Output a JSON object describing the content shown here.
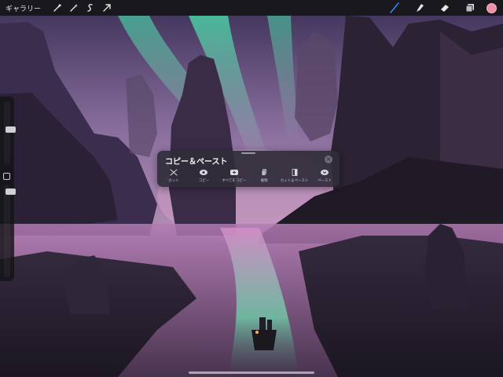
{
  "topbar": {
    "gallery_label": "ギャラリー",
    "left_tools": [
      "wrench-icon",
      "magic-wand-icon",
      "selection-icon",
      "transform-arrow-icon"
    ],
    "right_tools": [
      "brush-icon",
      "smudge-icon",
      "eraser-icon",
      "layers-icon"
    ],
    "active_color": "#f08fa8",
    "active_tool_color": "#3d7bff"
  },
  "copy_paste_panel": {
    "title": "コピー＆ペースト",
    "actions": [
      {
        "label": "カット",
        "icon": "scissors-icon"
      },
      {
        "label": "コピー",
        "icon": "copy-icon"
      },
      {
        "label": "すべてをコピー",
        "icon": "copy-all-icon"
      },
      {
        "label": "複製",
        "icon": "duplicate-icon"
      },
      {
        "label": "カット＆ペースト",
        "icon": "cut-paste-icon"
      },
      {
        "label": "ペースト",
        "icon": "paste-icon"
      }
    ]
  },
  "sidebar": {
    "brush_size_level": 0.55,
    "opacity_level": 0.55
  }
}
